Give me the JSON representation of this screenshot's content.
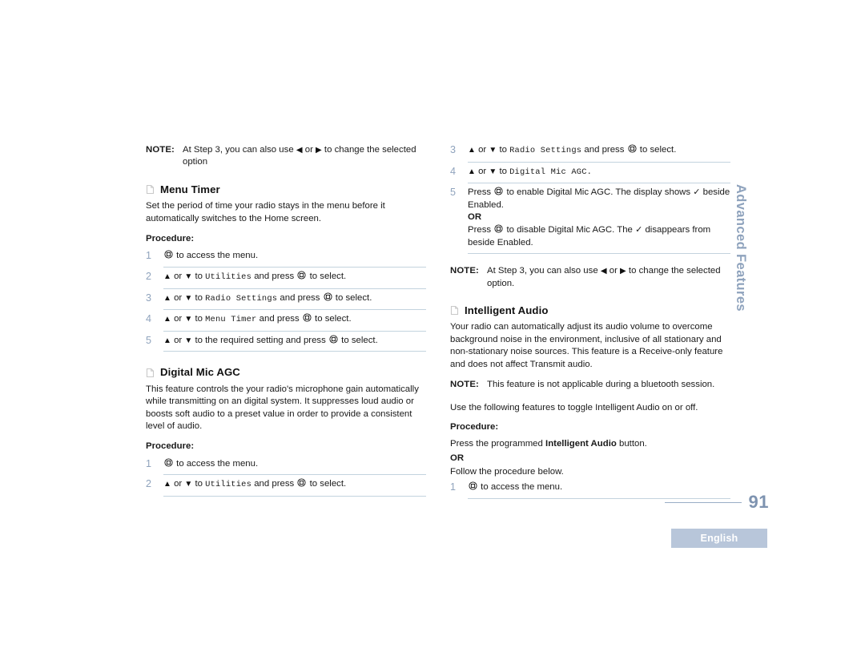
{
  "page": {
    "number": "91",
    "language_badge": "English",
    "side_tab": "Advanced Features"
  },
  "icons": {
    "document": "document-icon",
    "menu_button": "menu-button-icon",
    "arrow_up": "▲",
    "arrow_down": "▼",
    "arrow_left": "◀",
    "arrow_right": "▶",
    "check": "✓"
  },
  "labels": {
    "note": "NOTE:",
    "procedure": "Procedure:",
    "or": "OR"
  },
  "colors": {
    "step_number": "#8fa3bd",
    "rule": "#c3d3de",
    "page_number": "#7e93b0",
    "badge_bg": "#b8c6da",
    "side_tab": "#8fa3bd"
  },
  "left_column": {
    "top_note": {
      "label": "NOTE:",
      "text_before": "At Step 3, you can also use",
      "text_middle": "or",
      "text_after": "to change the selected option"
    },
    "menu_timer": {
      "title": "Menu Timer",
      "body": "Set the period of time your radio stays in the menu before it automatically switches to the Home screen.",
      "procedure_label": "Procedure:",
      "steps": [
        {
          "num": "1",
          "parts": [
            "menu-button",
            " to access the menu."
          ]
        },
        {
          "num": "2",
          "prefix": " or ",
          "to": "to",
          "mono": "Utilities",
          "mid": "and press",
          "suffix": "to select."
        },
        {
          "num": "3",
          "prefix": " or ",
          "to": "to",
          "mono": "Radio Settings",
          "mid": "and press",
          "suffix": "to select."
        },
        {
          "num": "4",
          "prefix": " or ",
          "to": "to",
          "mono": "Menu Timer",
          "mid": "and press",
          "suffix": "to select."
        },
        {
          "num": "5",
          "prefix": " or ",
          "to": "to the required setting and press",
          "mono": "",
          "mid": "",
          "suffix": "to select."
        }
      ]
    },
    "digital_mic_agc": {
      "title": "Digital Mic AGC",
      "body": "This feature controls the your radio's microphone gain automatically while transmitting on an digital system. It suppresses loud audio or boosts soft audio to a preset value in order to provide a consistent level of audio.",
      "procedure_label": "Procedure:",
      "steps": [
        {
          "num": "1",
          "text": " to access the menu."
        },
        {
          "num": "2",
          "prefix": " or ",
          "to": "to",
          "mono": "Utilities",
          "mid": "and press",
          "suffix": "to select."
        }
      ]
    }
  },
  "right_column": {
    "agc_steps": [
      {
        "num": "3",
        "prefix": " or ",
        "to": "to",
        "mono": "Radio Settings",
        "mid": "and press",
        "suffix": "to select."
      },
      {
        "num": "4",
        "prefix": " or ",
        "to": "to",
        "mono": "Digital Mic AGC.",
        "mid": "",
        "suffix": ""
      }
    ],
    "step5": {
      "num": "5",
      "line1_a": "Press",
      "line1_b": "to enable Digital Mic AGC. The display shows",
      "line1_c": "beside Enabled.",
      "or": "OR",
      "line2_a": "Press",
      "line2_b": "to disable Digital Mic AGC. The",
      "line2_c": "disappears from beside Enabled."
    },
    "note": {
      "label": "NOTE:",
      "text_before": "At Step 3, you can also use",
      "text_middle": "or",
      "text_after": "to change the selected option."
    },
    "intelligent_audio": {
      "title": "Intelligent Audio",
      "body": "Your radio can automatically adjust its audio volume to overcome background noise in the environment, inclusive of all stationary and non-stationary noise sources. This feature is a Receive-only feature and does not affect Transmit audio.",
      "note": {
        "label": "NOTE:",
        "text": "This feature is not applicable during a bluetooth session."
      },
      "intro": "Use the following features to toggle Intelligent Audio on or off.",
      "procedure_label": "Procedure:",
      "press_a": "Press the programmed",
      "press_bold": "Intelligent Audio",
      "press_b": "button.",
      "or": "OR",
      "follow": "Follow the procedure below.",
      "steps": [
        {
          "num": "1",
          "text": " to access the menu."
        }
      ]
    }
  }
}
